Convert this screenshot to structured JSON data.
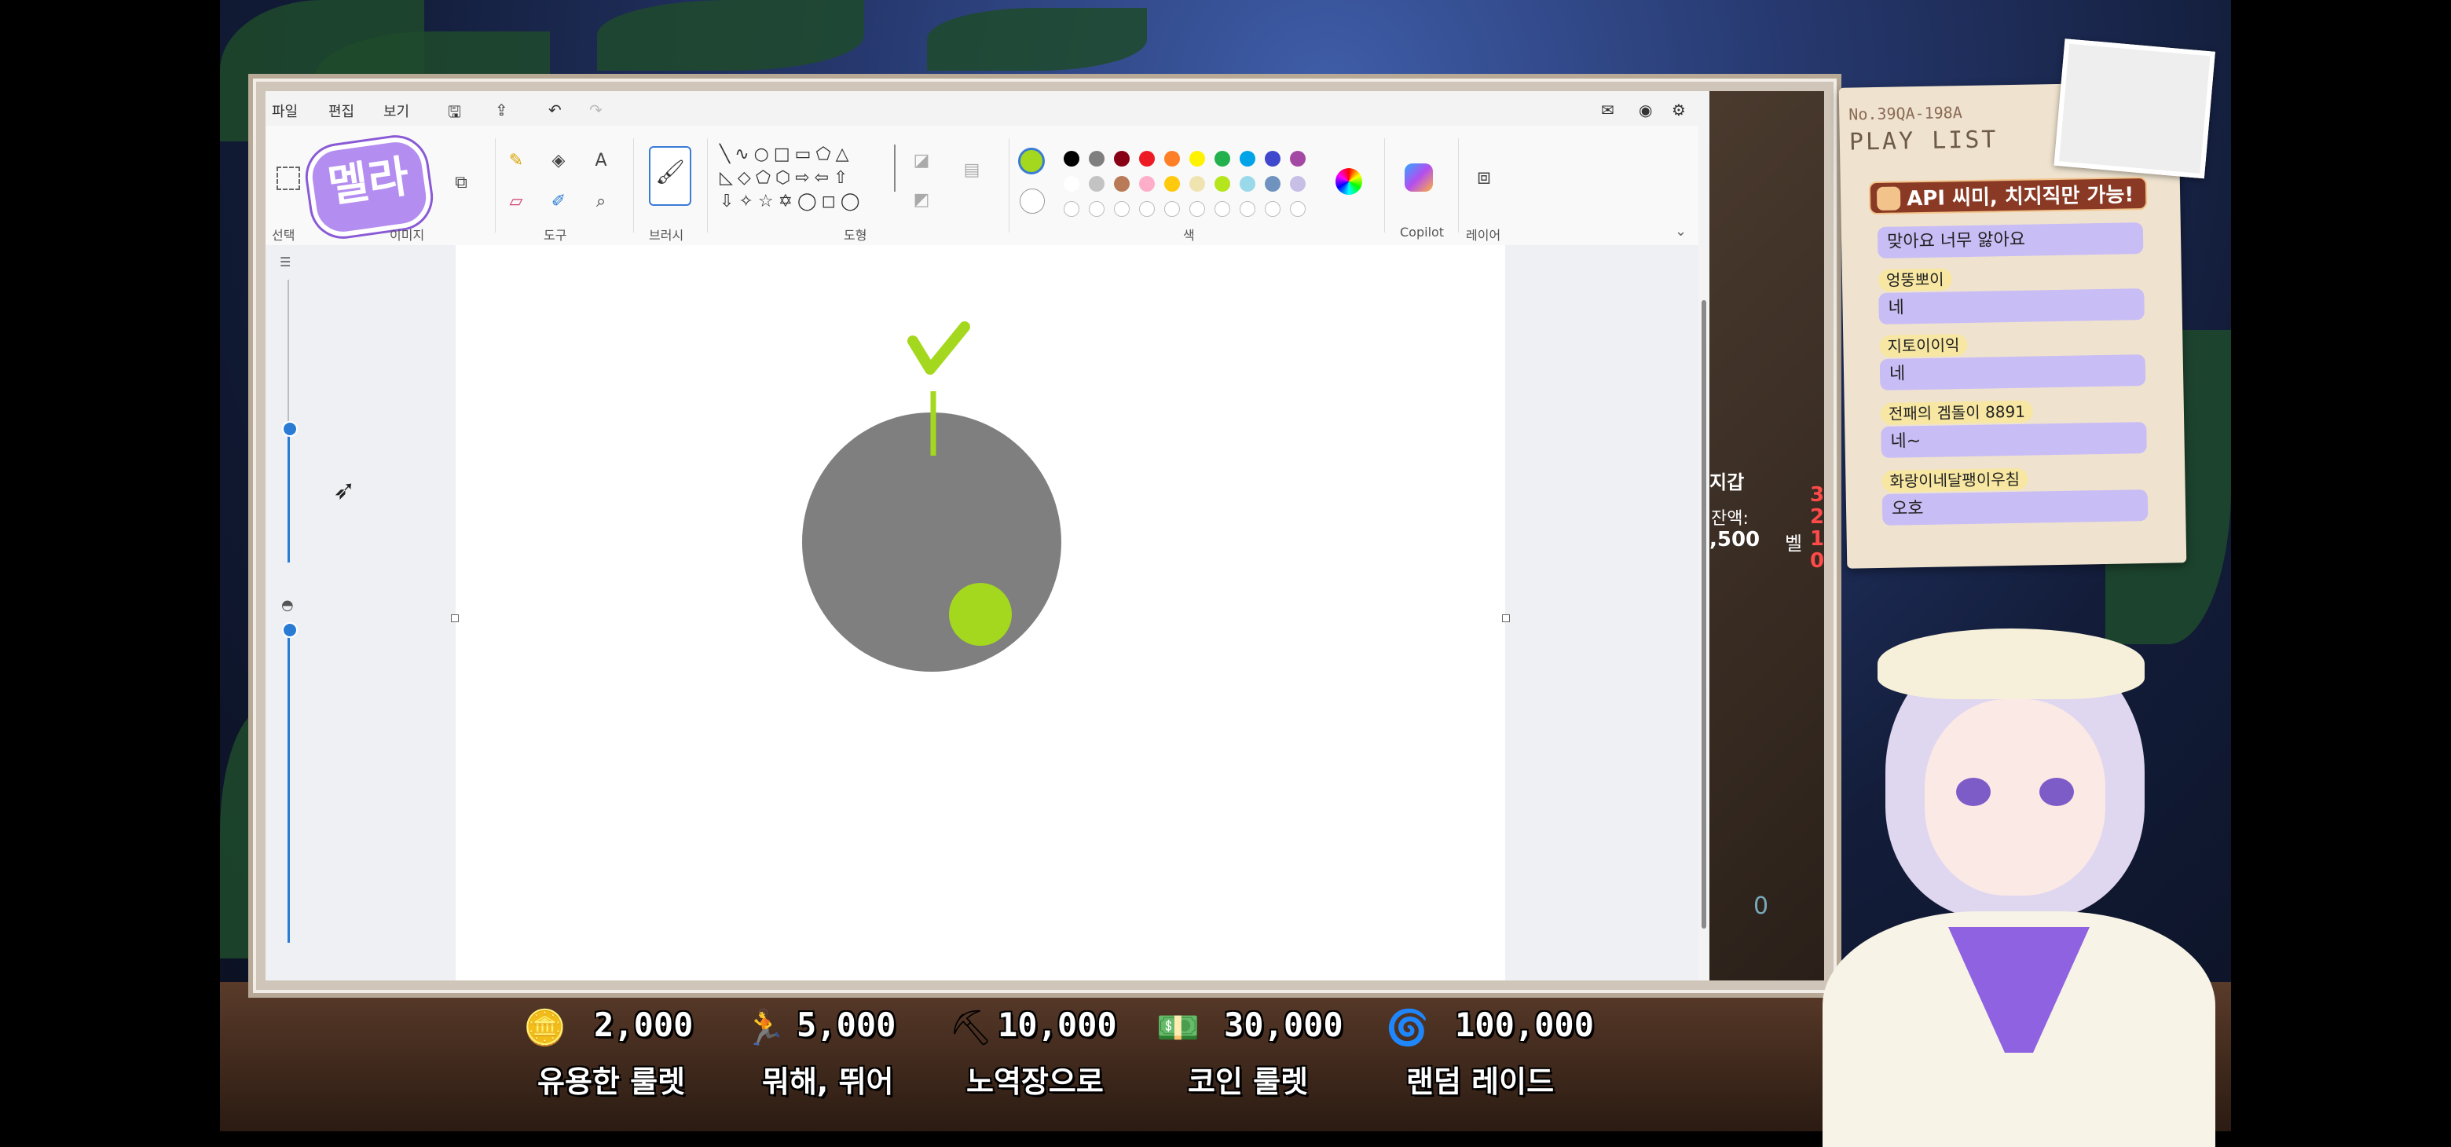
{
  "menu": {
    "file": "파일",
    "edit": "편집",
    "view": "보기"
  },
  "ribbon": {
    "groups": {
      "select": "선택",
      "image": "이미지",
      "tools": "도구",
      "brush": "브러시",
      "shapes": "도형",
      "colors": "색",
      "copilot": "Copilot",
      "layers": "레이어"
    },
    "logo_text": "멜라",
    "text_tool_glyph": "A"
  },
  "palette": {
    "primary": "#a4d81e",
    "row1": [
      "#000000",
      "#7f7f7f",
      "#880015",
      "#ed1c24",
      "#ff7f27",
      "#fff200",
      "#22b14c",
      "#00a2e8",
      "#3f48cc",
      "#a349a4"
    ],
    "row2": [
      "#ffffff",
      "#c3c3c3",
      "#b97a57",
      "#ffaec9",
      "#ffc90e",
      "#efe4b0",
      "#b5e61d",
      "#99d9ea",
      "#7092be",
      "#c8bfe7"
    ]
  },
  "drawing": {
    "circle_color": "#7f7f7f",
    "accent_color": "#a4d81e"
  },
  "overlay_right": {
    "label": "지갑",
    "balance_label": "잔액:",
    "balance_value": ",500",
    "unit": "벨",
    "counter": "0",
    "digits": [
      "3",
      "2",
      "1",
      "0"
    ]
  },
  "playlist": {
    "code": "No.39QA-198A",
    "title": "PLAY LIST",
    "banner": "API 씨미, 치지직만 가능!",
    "messages": [
      {
        "name": "",
        "text": "맞아요 너무 앓아요"
      },
      {
        "name": "엉뚱뽀이",
        "text": "네"
      },
      {
        "name": "지토이이익",
        "text": "네"
      },
      {
        "name": "전패의 겜돌이 8891",
        "text": "네~"
      },
      {
        "name": "화랑이네달팽이우침",
        "text": "오호"
      }
    ]
  },
  "donations": [
    {
      "amount": "2,000",
      "caption": "유용한 룰렛"
    },
    {
      "amount": "5,000",
      "caption": "뭐해, 뛰어"
    },
    {
      "amount": "10,000",
      "caption": "노역장으로"
    },
    {
      "amount": "30,000",
      "caption": "코인 룰렛"
    },
    {
      "amount": "100,000",
      "caption": "랜덤 레이드"
    }
  ]
}
